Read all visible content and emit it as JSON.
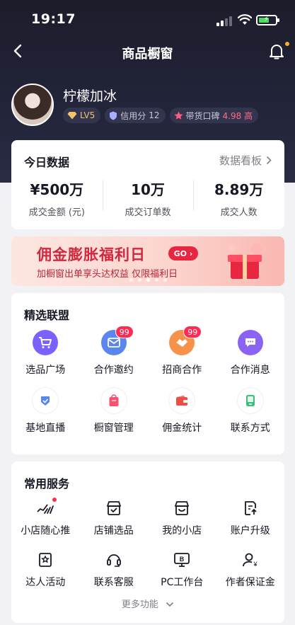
{
  "status_bar": {
    "time": "19:17"
  },
  "nav": {
    "title": "商品橱窗"
  },
  "profile": {
    "name": "柠檬加冰",
    "level": "LV5",
    "credit_label": "信用分",
    "credit_value": "12",
    "reputation_label": "带货口碑",
    "reputation_value": "4.98 高"
  },
  "today": {
    "title": "今日数据",
    "link": "数据看板",
    "stats": [
      {
        "value": "¥500万",
        "label": "成交金额 (元)"
      },
      {
        "value": "10万",
        "label": "成交订单数"
      },
      {
        "value": "8.89万",
        "label": "成交人数"
      }
    ]
  },
  "banner": {
    "title": "佣金膨胀福利日",
    "go": "GO",
    "subtitle": "加橱窗出单享头达权益 仅限福利日"
  },
  "union": {
    "title": "精选联盟",
    "items": [
      {
        "label": "选品广场",
        "icon": "cart-icon"
      },
      {
        "label": "合作邀约",
        "icon": "mail-icon",
        "badge": "99"
      },
      {
        "label": "招商合作",
        "icon": "handshake-icon",
        "badge": "99"
      },
      {
        "label": "合作消息",
        "icon": "chat-icon"
      },
      {
        "label": "基地直播",
        "icon": "live-base-icon"
      },
      {
        "label": "橱窗管理",
        "icon": "shop-bag-icon"
      },
      {
        "label": "佣金统计",
        "icon": "wallet-icon"
      },
      {
        "label": "联系方式",
        "icon": "phone-icon"
      }
    ]
  },
  "services": {
    "title": "常用服务",
    "items": [
      {
        "label": "小店随心推",
        "icon": "promote-icon"
      },
      {
        "label": "店铺选品",
        "icon": "store-select-icon"
      },
      {
        "label": "我的小店",
        "icon": "my-store-icon"
      },
      {
        "label": "账户升级",
        "icon": "account-upgrade-icon"
      },
      {
        "label": "达人活动",
        "icon": "creator-activity-icon"
      },
      {
        "label": "联系客服",
        "icon": "headset-icon"
      },
      {
        "label": "PC工作台",
        "icon": "pc-workbench-icon"
      },
      {
        "label": "作者保证金",
        "icon": "deposit-icon"
      }
    ],
    "more": "更多功能"
  },
  "colors": {
    "accent": "#fe2c55",
    "header_bg": "#1c1d2b",
    "gold": "#f3c56b"
  }
}
